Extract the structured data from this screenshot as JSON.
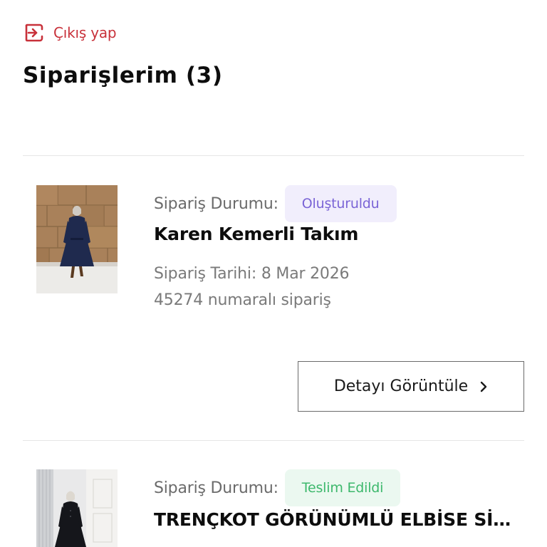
{
  "header": {
    "logout_label": "Çıkış yap",
    "page_title": "Siparişlerim (3)"
  },
  "colors": {
    "accent": "#c8313a",
    "badge_created_bg": "#f1eefc",
    "badge_created_text": "#7a64d6",
    "badge_delivered_bg": "#ebf8f0",
    "badge_delivered_text": "#3db86c"
  },
  "orders": [
    {
      "status_label": "Sipariş Durumu:",
      "status": "Oluşturuldu",
      "product_name": "Karen Kemerli Takım",
      "order_date": "Sipariş Tarihi: 8 Mar 2026",
      "order_number": "45274 numaralı sipariş",
      "detail_label": "Detayı Görüntüle",
      "thumbnail": "woman-in-navy-dress-photo"
    },
    {
      "status_label": "Sipariş Durumu:",
      "status": "Teslim Edildi",
      "product_name": "TRENÇKOT GÖRÜNÜMLÜ ELBİSE SİYAH",
      "thumbnail": "woman-in-black-dress-photo"
    }
  ],
  "icons": {
    "logout": "logout-icon",
    "chevron": "chevron-right-icon"
  }
}
